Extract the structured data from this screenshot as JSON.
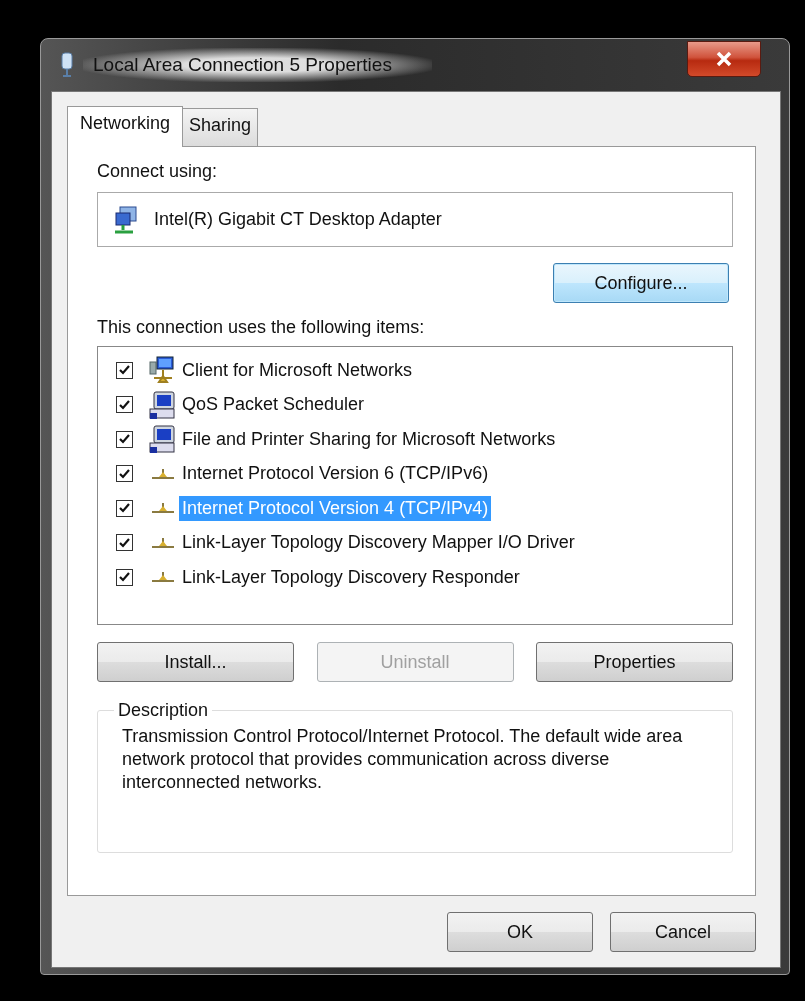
{
  "window": {
    "title": "Local Area Connection 5 Properties"
  },
  "tabs": [
    {
      "label": "Networking",
      "selected": true
    },
    {
      "label": "Sharing",
      "selected": false
    }
  ],
  "connect_using": {
    "label": "Connect using:",
    "adapter": "Intel(R) Gigabit CT Desktop Adapter",
    "configure_button": "Configure..."
  },
  "items_label": "This connection uses the following items:",
  "items": [
    {
      "label": "Client for Microsoft Networks",
      "kind": "client",
      "checked": true,
      "selected": false
    },
    {
      "label": "QoS Packet Scheduler",
      "kind": "service",
      "checked": true,
      "selected": false
    },
    {
      "label": "File and Printer Sharing for Microsoft Networks",
      "kind": "service",
      "checked": true,
      "selected": false
    },
    {
      "label": "Internet Protocol Version 6 (TCP/IPv6)",
      "kind": "protocol",
      "checked": true,
      "selected": false
    },
    {
      "label": "Internet Protocol Version 4 (TCP/IPv4)",
      "kind": "protocol",
      "checked": true,
      "selected": true
    },
    {
      "label": "Link-Layer Topology Discovery Mapper I/O Driver",
      "kind": "protocol",
      "checked": true,
      "selected": false
    },
    {
      "label": "Link-Layer Topology Discovery Responder",
      "kind": "protocol",
      "checked": true,
      "selected": false
    }
  ],
  "item_buttons": [
    {
      "label": "Install...",
      "disabled": false
    },
    {
      "label": "Uninstall",
      "disabled": true
    },
    {
      "label": "Properties",
      "disabled": false
    }
  ],
  "description": {
    "legend": "Description",
    "text": "Transmission Control Protocol/Internet Protocol. The default wide area network protocol that provides communication across diverse interconnected networks."
  },
  "dialog_buttons": [
    {
      "label": "OK",
      "disabled": false
    },
    {
      "label": "Cancel",
      "disabled": false
    }
  ]
}
